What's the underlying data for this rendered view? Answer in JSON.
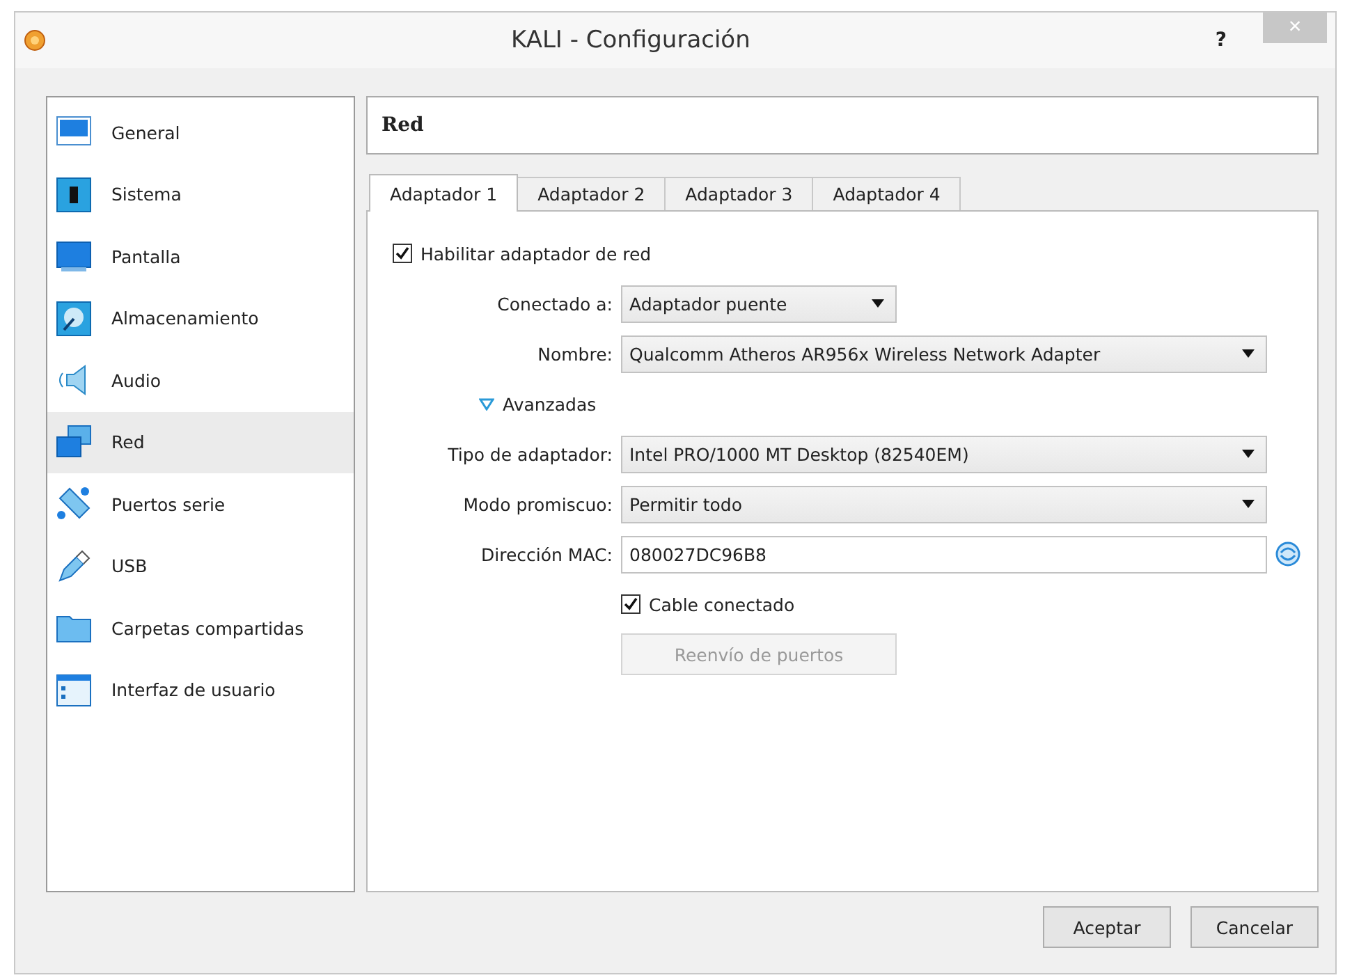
{
  "window": {
    "title": "KALI - Configuración",
    "help": "?",
    "close": "×"
  },
  "sidebar": {
    "items": [
      {
        "label": "General",
        "kind": "general",
        "selected": false
      },
      {
        "label": "Sistema",
        "kind": "system",
        "selected": false
      },
      {
        "label": "Pantalla",
        "kind": "display",
        "selected": false
      },
      {
        "label": "Almacenamiento",
        "kind": "storage",
        "selected": false
      },
      {
        "label": "Audio",
        "kind": "audio",
        "selected": false
      },
      {
        "label": "Red",
        "kind": "network",
        "selected": true
      },
      {
        "label": "Puertos serie",
        "kind": "serial",
        "selected": false
      },
      {
        "label": "USB",
        "kind": "usb",
        "selected": false
      },
      {
        "label": "Carpetas compartidas",
        "kind": "folder",
        "selected": false
      },
      {
        "label": "Interfaz de usuario",
        "kind": "ui",
        "selected": false
      }
    ]
  },
  "page": {
    "title": "Red"
  },
  "tabs": [
    {
      "label": "Adaptador 1",
      "selected": true
    },
    {
      "label": "Adaptador 2",
      "selected": false
    },
    {
      "label": "Adaptador 3",
      "selected": false
    },
    {
      "label": "Adaptador 4",
      "selected": false
    }
  ],
  "rows": [
    {
      "kind": "check",
      "label": "Habilitar adaptador de red",
      "checked": true
    },
    {
      "kind": "short-combo",
      "label": "Conectado a:",
      "value": "Adaptador puente"
    },
    {
      "kind": "combo",
      "label": "Nombre:",
      "value": "Qualcomm Atheros AR956x Wireless Network Adapter"
    },
    {
      "kind": "expander",
      "label": "Avanzadas",
      "expanded": true
    },
    {
      "kind": "combo",
      "label": "Tipo de adaptador:",
      "value": "Intel PRO/1000 MT Desktop (82540EM)"
    },
    {
      "kind": "combo",
      "label": "Modo promiscuo:",
      "value": "Permitir todo"
    },
    {
      "kind": "text",
      "label": "Dirección MAC:",
      "value": "080027DC96B8"
    },
    {
      "kind": "indent-check",
      "label": "Cable conectado",
      "checked": true
    },
    {
      "kind": "button",
      "label": "Reenvío de puertos",
      "disabled": true
    }
  ],
  "buttons": [
    {
      "label": "Aceptar"
    },
    {
      "label": "Cancelar"
    }
  ]
}
